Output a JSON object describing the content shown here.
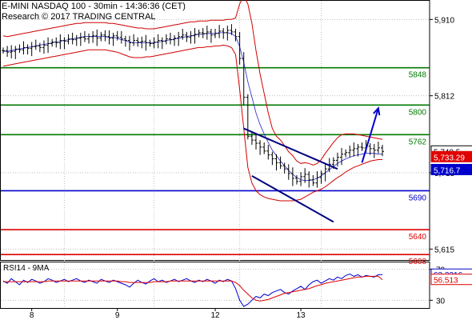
{
  "header": {
    "title": "E-MINI NASDAQ 100 - 30min - 14:36:36 (CET)",
    "research": "Research © 2017 TRADING CENTRAL"
  },
  "chart_data": [
    {
      "type": "candlestick",
      "title": "E-MINI NASDAQ 100 - 30min - 14:36:36 (CET)",
      "ylim": [
        5601,
        5935
      ],
      "y_ticks": [
        5910,
        5812,
        5713,
        5615
      ],
      "y_tick_labels": [
        "5,910",
        "5,812",
        "5,713",
        "5,615"
      ],
      "x_tick_labels": [
        "8",
        "9",
        "12",
        "13"
      ],
      "grid": true,
      "last_price": {
        "value": 5740.5,
        "label": "5,740.5"
      },
      "price_tags": [
        {
          "label": "5,733.29",
          "value": 5733.29,
          "color": "#e00000"
        },
        {
          "label": "5,716.7",
          "value": 5716.7,
          "color": "#0000cc"
        }
      ],
      "levels": [
        {
          "value": 5848,
          "label": "5848",
          "color": "#007a00"
        },
        {
          "value": 5800,
          "label": "5800",
          "color": "#007a00"
        },
        {
          "value": 5762,
          "label": "5762",
          "color": "#007a00"
        },
        {
          "value": 5690,
          "label": "5690",
          "color": "#0000cc"
        },
        {
          "value": 5640,
          "label": "5640",
          "color": "#e00000"
        },
        {
          "value": 5608,
          "label": "5608",
          "color": "#e00000"
        }
      ],
      "series_close": [
        5870,
        5868,
        5869,
        5872,
        5871,
        5874,
        5873,
        5875,
        5876,
        5874,
        5877,
        5879,
        5881,
        5880,
        5883,
        5882,
        5885,
        5884,
        5886,
        5887,
        5885,
        5888,
        5889,
        5886,
        5890,
        5888,
        5886,
        5889,
        5887,
        5885,
        5883,
        5880,
        5883,
        5881,
        5882,
        5880,
        5879,
        5881,
        5883,
        5882,
        5885,
        5884,
        5886,
        5888,
        5890,
        5887,
        5889,
        5891,
        5893,
        5892,
        5894,
        5890,
        5892,
        5895,
        5893,
        5896,
        5894,
        5888,
        5860,
        5810,
        5760,
        5755,
        5751,
        5746,
        5741,
        5736,
        5731,
        5726,
        5722,
        5718,
        5712,
        5706,
        5702,
        5708,
        5711,
        5704,
        5700,
        5707,
        5712,
        5718,
        5724,
        5729,
        5733,
        5737,
        5739,
        5742,
        5744,
        5746,
        5745,
        5747,
        5744,
        5742,
        5745,
        5740.5
      ],
      "bollinger": {
        "upper": [
          5889,
          5888,
          5889,
          5890,
          5891,
          5892,
          5893,
          5894,
          5895,
          5896,
          5897,
          5898,
          5899,
          5900,
          5901,
          5902,
          5903,
          5904,
          5905,
          5905,
          5906,
          5906,
          5906,
          5906,
          5906,
          5906,
          5905,
          5905,
          5904,
          5903,
          5902,
          5901,
          5900,
          5899,
          5899,
          5898,
          5898,
          5898,
          5899,
          5900,
          5901,
          5902,
          5903,
          5904,
          5905,
          5906,
          5907,
          5907,
          5908,
          5908,
          5908,
          5909,
          5909,
          5909,
          5909,
          5910,
          5910,
          5912,
          5930,
          5940,
          5930,
          5905,
          5870,
          5840,
          5815,
          5790,
          5770,
          5760,
          5755,
          5748,
          5740,
          5735,
          5728,
          5725,
          5726,
          5725,
          5723,
          5725,
          5730,
          5738,
          5745,
          5752,
          5758,
          5762,
          5763,
          5763,
          5763,
          5762,
          5761,
          5760,
          5759,
          5758,
          5757,
          5756
        ],
        "lower": [
          5850,
          5851,
          5852,
          5853,
          5854,
          5855,
          5856,
          5857,
          5858,
          5859,
          5860,
          5861,
          5862,
          5863,
          5864,
          5865,
          5866,
          5867,
          5868,
          5869,
          5870,
          5871,
          5871,
          5871,
          5871,
          5871,
          5870,
          5869,
          5868,
          5866,
          5864,
          5862,
          5861,
          5861,
          5861,
          5862,
          5862,
          5863,
          5864,
          5865,
          5866,
          5867,
          5868,
          5869,
          5870,
          5871,
          5872,
          5873,
          5874,
          5874,
          5875,
          5875,
          5876,
          5876,
          5877,
          5876,
          5874,
          5865,
          5820,
          5770,
          5720,
          5700,
          5690,
          5685,
          5682,
          5680,
          5679,
          5678,
          5677,
          5677,
          5677,
          5677,
          5678,
          5679,
          5682,
          5685,
          5688,
          5690,
          5692,
          5695,
          5699,
          5703,
          5707,
          5710,
          5714,
          5717,
          5720,
          5722,
          5724,
          5726,
          5728,
          5729,
          5730,
          5730
        ],
        "ma20": [
          5869,
          5869,
          5870,
          5871,
          5872,
          5873,
          5874,
          5875,
          5876,
          5877,
          5878,
          5879,
          5880,
          5881,
          5882,
          5883,
          5884,
          5885,
          5886,
          5887,
          5888,
          5888,
          5888,
          5888,
          5888,
          5888,
          5887,
          5887,
          5886,
          5884,
          5883,
          5881,
          5880,
          5880,
          5880,
          5880,
          5880,
          5880,
          5881,
          5882,
          5883,
          5884,
          5885,
          5886,
          5887,
          5888,
          5889,
          5890,
          5891,
          5891,
          5892,
          5892,
          5892,
          5893,
          5893,
          5893,
          5892,
          5888,
          5875,
          5855,
          5830,
          5810,
          5790,
          5775,
          5763,
          5752,
          5742,
          5735,
          5728,
          5722,
          5716,
          5711,
          5707,
          5704,
          5703,
          5703,
          5704,
          5706,
          5709,
          5713,
          5717,
          5721,
          5725,
          5728,
          5731,
          5733,
          5735,
          5736,
          5737,
          5738,
          5738,
          5738,
          5737,
          5737
        ]
      },
      "trend_lines": [
        {
          "from": [
            59,
            5770
          ],
          "to": [
            82,
            5718
          ],
          "color": "#000080"
        },
        {
          "from": [
            61,
            5709
          ],
          "to": [
            81,
            5650
          ],
          "color": "#000080"
        }
      ],
      "forecast_arrow": {
        "from": [
          88,
          5726
        ],
        "to": [
          92,
          5796
        ],
        "color": "#0000cc"
      }
    },
    {
      "type": "line",
      "title": "RSI14 - 9MA",
      "ylim": [
        20,
        80
      ],
      "y_ticks": [
        70,
        30
      ],
      "y_tick_labels": [
        "70",
        "30"
      ],
      "last_value_tags": [
        {
          "label": "63.2216",
          "value": 63.2216,
          "color": "#0000cc"
        },
        {
          "label": "56.513",
          "value": 56.513,
          "color": "#e00000"
        }
      ],
      "series": [
        {
          "name": "RSI14",
          "color": "#0000cc",
          "values": [
            55,
            52,
            58,
            54,
            50,
            56,
            53,
            57,
            55,
            52,
            54,
            58,
            56,
            53,
            55,
            57,
            54,
            56,
            58,
            55,
            53,
            56,
            54,
            52,
            57,
            55,
            53,
            56,
            54,
            52,
            50,
            47,
            52,
            56,
            53,
            51,
            55,
            58,
            54,
            56,
            53,
            55,
            57,
            54,
            56,
            58,
            55,
            53,
            56,
            54,
            57,
            55,
            52,
            56,
            54,
            57,
            55,
            45,
            30,
            22,
            25,
            30,
            35,
            33,
            38,
            36,
            40,
            42,
            44,
            40,
            38,
            42,
            45,
            48,
            44,
            50,
            54,
            56,
            52,
            55,
            58,
            56,
            60,
            58,
            62,
            64,
            61,
            63,
            60,
            62,
            61,
            60,
            63,
            63.2216
          ]
        },
        {
          "name": "9MA",
          "color": "#e00000",
          "values": [
            54,
            54,
            54,
            54,
            54,
            54,
            54,
            54,
            54,
            54,
            54,
            55,
            55,
            55,
            55,
            55,
            55,
            55,
            55,
            55,
            55,
            55,
            55,
            55,
            55,
            55,
            55,
            55,
            55,
            54,
            54,
            53,
            53,
            53,
            53,
            53,
            53,
            54,
            54,
            54,
            54,
            55,
            55,
            55,
            55,
            55,
            55,
            55,
            55,
            55,
            55,
            55,
            55,
            55,
            55,
            55,
            55,
            53,
            49,
            43,
            38,
            33,
            30,
            29,
            30,
            31,
            33,
            35,
            37,
            39,
            40,
            41,
            42,
            43,
            44,
            45,
            47,
            49,
            50,
            52,
            53,
            54,
            55,
            56,
            57,
            58,
            59,
            60,
            60,
            61,
            61,
            61,
            61,
            56.513
          ]
        }
      ]
    }
  ],
  "x_axis": {
    "labels": [
      "8",
      "9",
      "12",
      "13"
    ]
  }
}
